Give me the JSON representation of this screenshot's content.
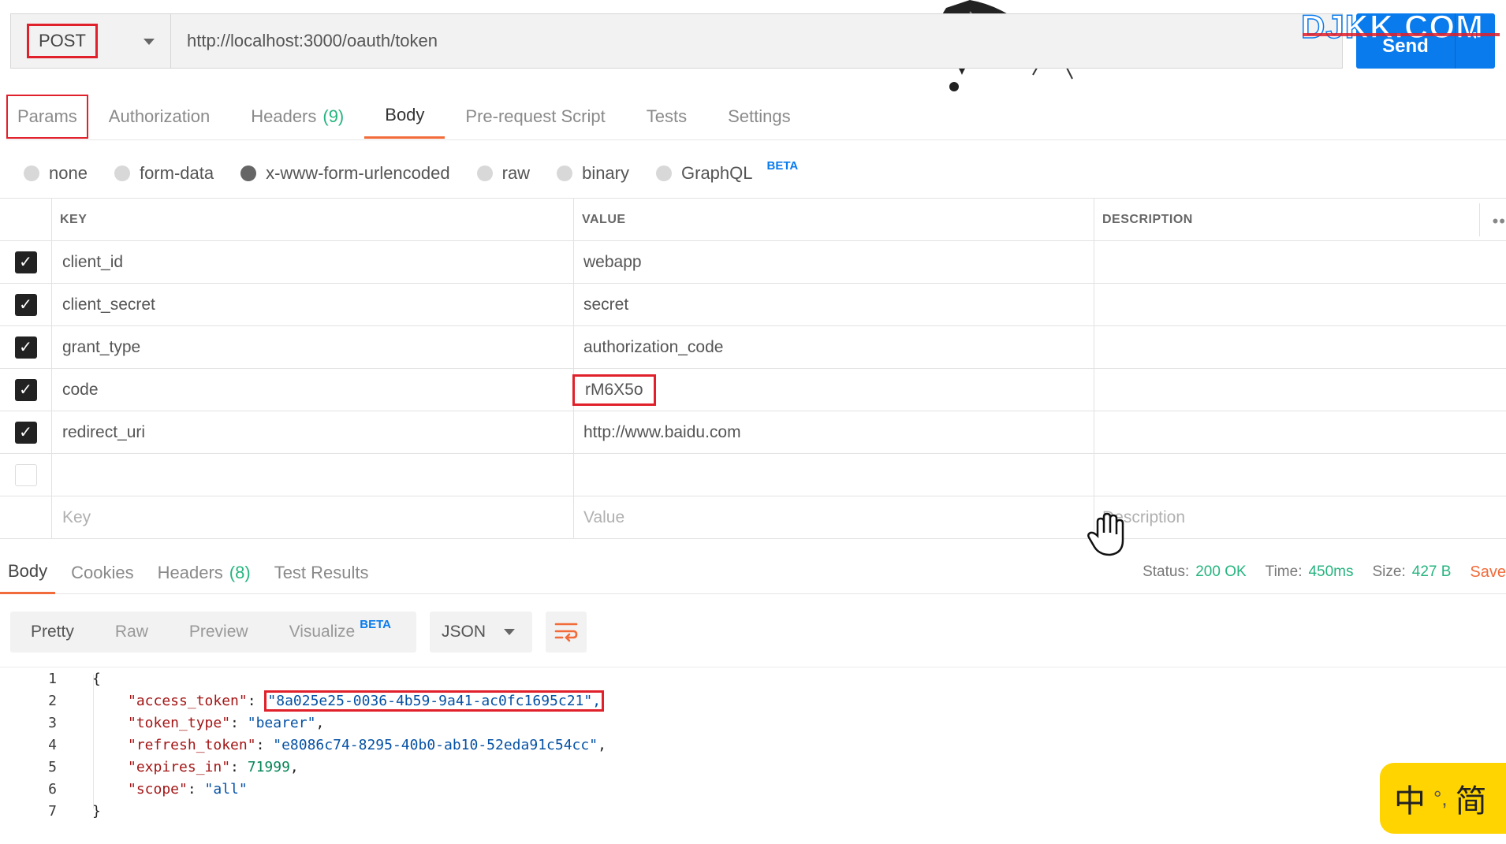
{
  "request": {
    "method": "POST",
    "url": "http://localhost:3000/oauth/token",
    "send_label": "Send",
    "watermark": "DJKK.COM"
  },
  "request_tabs": [
    {
      "label": "Params",
      "count": ""
    },
    {
      "label": "Authorization",
      "count": ""
    },
    {
      "label": "Headers",
      "count": "(9)"
    },
    {
      "label": "Body",
      "count": ""
    },
    {
      "label": "Pre-request Script",
      "count": ""
    },
    {
      "label": "Tests",
      "count": ""
    },
    {
      "label": "Settings",
      "count": ""
    }
  ],
  "body_types": {
    "none": "none",
    "form_data": "form-data",
    "urlencoded": "x-www-form-urlencoded",
    "raw": "raw",
    "binary": "binary",
    "graphql": "GraphQL",
    "graphql_badge": "BETA",
    "selected": "x-www-form-urlencoded"
  },
  "params_table": {
    "headers": {
      "key": "KEY",
      "value": "VALUE",
      "description": "DESCRIPTION"
    },
    "rows": [
      {
        "checked": true,
        "key": "client_id",
        "value": "webapp",
        "description": ""
      },
      {
        "checked": true,
        "key": "client_secret",
        "value": "secret",
        "description": ""
      },
      {
        "checked": true,
        "key": "grant_type",
        "value": "authorization_code",
        "description": ""
      },
      {
        "checked": true,
        "key": "code",
        "value": "rM6X5o",
        "description": ""
      },
      {
        "checked": true,
        "key": "redirect_uri",
        "value": "http://www.baidu.com",
        "description": ""
      },
      {
        "checked": false,
        "key": "",
        "value": "",
        "description": ""
      }
    ],
    "placeholders": {
      "key": "Key",
      "value": "Value",
      "description": "Description"
    }
  },
  "response_tabs": [
    {
      "label": "Body",
      "count": ""
    },
    {
      "label": "Cookies",
      "count": ""
    },
    {
      "label": "Headers",
      "count": "(8)"
    },
    {
      "label": "Test Results",
      "count": ""
    }
  ],
  "response_meta": {
    "status_label": "Status:",
    "status_value": "200 OK",
    "time_label": "Time:",
    "time_value": "450ms",
    "size_label": "Size:",
    "size_value": "427 B",
    "save_label": "Save"
  },
  "format_buttons": {
    "pretty": "Pretty",
    "raw": "Raw",
    "preview": "Preview",
    "visualize": "Visualize",
    "visualize_badge": "BETA",
    "language": "JSON"
  },
  "code": {
    "lines": [
      "1",
      "2",
      "3",
      "4",
      "5",
      "6",
      "7"
    ],
    "open_brace": "{",
    "close_brace": "}",
    "access_token_key": "\"access_token\"",
    "access_token_value": "\"8a025e25-0036-4b59-9a41-ac0fc1695c21\",",
    "token_type_key": "\"token_type\"",
    "token_type_value": "\"bearer\"",
    "refresh_token_key": "\"refresh_token\"",
    "refresh_token_value": "\"e8086c74-8295-40b0-ab10-52eda91c54cc\"",
    "expires_in_key": "\"expires_in\"",
    "expires_in_value": "71999",
    "scope_key": "\"scope\"",
    "scope_value": "\"all\""
  },
  "ime": {
    "lang": "中",
    "sep": "°,",
    "mode": "简"
  },
  "colors": {
    "accent": "#f26b3a",
    "send": "#097bed",
    "success": "#26b47f",
    "highlight": "#e0202a"
  }
}
